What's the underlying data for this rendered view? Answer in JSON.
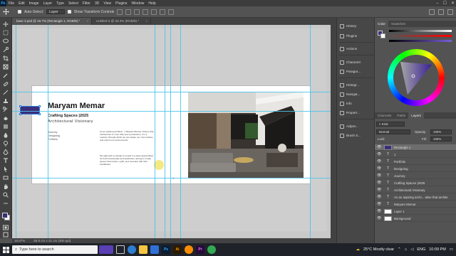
{
  "menubar": {
    "logo": "Ps",
    "items": [
      "File",
      "Edit",
      "Image",
      "Layer",
      "Type",
      "Select",
      "Filter",
      "3D",
      "View",
      "Plugins",
      "Window",
      "Help"
    ],
    "window_controls": [
      "–",
      "☐",
      "✕"
    ]
  },
  "options": {
    "auto_select_label": "Auto-Select:",
    "auto_select_target": "Layer",
    "transform_label": "Show Transform Controls"
  },
  "tabs": [
    {
      "label": "base 3.psd @ 16.7% (Rectangle 1, RGB/8) *",
      "active": true
    },
    {
      "label": "Untitled-2 @ 33.3% (RGB/8) *",
      "active": false
    }
  ],
  "artboard": {
    "name": "Maryam Memar",
    "tagline": "Crafting Spaces |2025",
    "role": "Architectural Visionary",
    "nav": [
      "Journey",
      "Designing",
      "Portfolio"
    ],
    "para1": "As an aspiring architect, I, Maryam Memar, believe that architecture is more than just a profession; it is a medium through which we can shape our communities and enrich our environments.",
    "para2": "My approach to design is rooted in a deep appreciation for both functionality and aesthetics, aiming to create spaces that inspire, uplift, and resonate with their inhabitants.",
    "page_number": "1"
  },
  "statusbar": {
    "zoom": "16.67%",
    "doc_size": "56.9 cm x 21 cm (300 ppi)"
  },
  "strip": [
    {
      "icon": "history-icon",
      "label": "History"
    },
    {
      "icon": "plugins-icon",
      "label": "Plugins"
    },
    {
      "icon": "actions-icon",
      "label": "Actions"
    },
    {
      "icon": "character-icon",
      "label": "Character"
    },
    {
      "icon": "paragraph-icon",
      "label": "Paragra..."
    },
    {
      "icon": "histogram-icon",
      "label": "Histogr..."
    },
    {
      "icon": "navigator-icon",
      "label": "Navigat..."
    },
    {
      "icon": "info-icon",
      "label": "Info"
    },
    {
      "icon": "properties-icon",
      "label": "Propert..."
    },
    {
      "icon": "adjustments-icon",
      "label": "Adjust..."
    },
    {
      "icon": "brush-settings-icon",
      "label": "Brush S..."
    }
  ],
  "color_panel": {
    "tabs": [
      "Color",
      "Swatches"
    ],
    "fg_color": "#3b2f7a"
  },
  "layers_panel": {
    "tabs": [
      "Channels",
      "Paths",
      "Layers"
    ],
    "kind_label": "Kind",
    "blend_mode": "Normal",
    "opacity_label": "Opacity:",
    "opacity_value": "100%",
    "lock_label": "Lock:",
    "fill_label": "Fill:",
    "fill_value": "100%",
    "layers": [
      {
        "name": "Rectangle 1",
        "type": "shape",
        "selected": true
      },
      {
        "name": "1",
        "type": "text",
        "selected": false
      },
      {
        "name": "Portfolio",
        "type": "text",
        "selected": false
      },
      {
        "name": "Designing",
        "type": "text",
        "selected": false
      },
      {
        "name": "Journey",
        "type": "text",
        "selected": false
      },
      {
        "name": "Crafting Spaces |2025",
        "type": "text",
        "selected": false
      },
      {
        "name": "Architectural Visionary",
        "type": "text",
        "selected": false
      },
      {
        "name": "As an aspiring archi... ative that archite",
        "type": "text",
        "selected": false
      },
      {
        "name": "Maryam Memar",
        "type": "text",
        "selected": false
      },
      {
        "name": "Layer 1",
        "type": "pixel",
        "selected": false
      },
      {
        "name": "Background",
        "type": "pixel",
        "selected": false
      }
    ]
  },
  "taskbar": {
    "search_placeholder": "Type here to search",
    "apps": [
      "Ps",
      "Ai",
      "Pr"
    ],
    "weather": "25°C Mostly clear",
    "lang": "ENG",
    "time": "10:09 PM"
  }
}
